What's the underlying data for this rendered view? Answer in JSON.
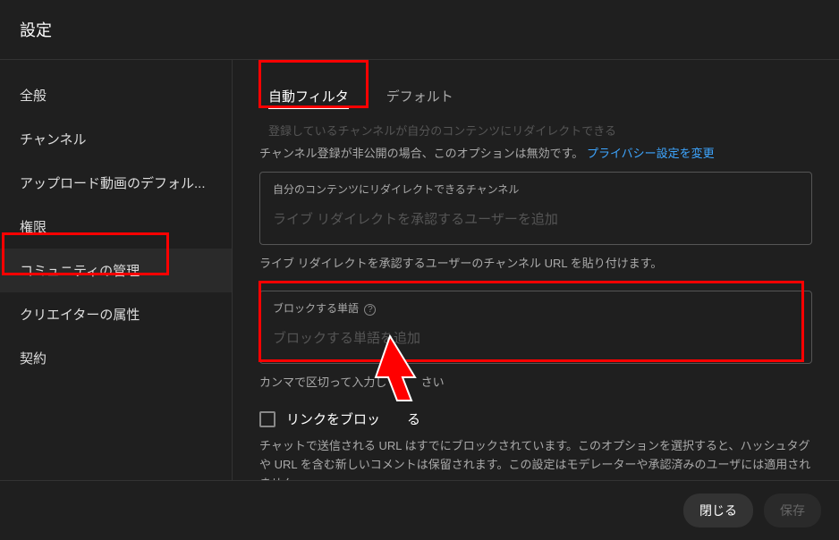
{
  "header": {
    "title": "設定"
  },
  "sidebar": {
    "items": [
      {
        "label": "全般"
      },
      {
        "label": "チャンネル"
      },
      {
        "label": "アップロード動画のデフォル..."
      },
      {
        "label": "権限"
      },
      {
        "label": "コミュニティの管理"
      },
      {
        "label": "クリエイターの属性"
      },
      {
        "label": "契約"
      }
    ]
  },
  "content": {
    "tabs": [
      {
        "label": "自動フィルタ",
        "active": true
      },
      {
        "label": "デフォルト",
        "active": false
      }
    ],
    "greyed_line": "登録しているチャンネルが自分のコンテンツにリダイレクトできる",
    "privacy_note": "チャンネル登録が非公開の場合、このオプションは無効です。",
    "privacy_link": "プライバシー設定を変更",
    "redirect_box": {
      "label": "自分のコンテンツにリダイレクトできるチャンネル",
      "placeholder": "ライブ リダイレクトを承認するユーザーを追加"
    },
    "redirect_help": "ライブ リダイレクトを承認するユーザーのチャンネル URL を貼り付けます。",
    "block_box": {
      "label": "ブロックする単語",
      "placeholder": "ブロックする単語を追加"
    },
    "block_help_partial": "カンマで区切って入力し",
    "block_help_suffix": "さい",
    "checkbox": {
      "label_a": "リンクをブロッ",
      "label_b": "る"
    },
    "description": "チャットで送信される URL はすでにブロックされています。このオプションを選択すると、ハッシュタグや URL を含む新しいコメントは保留されます。この設定はモデレーターや承認済みのユーザには適用されません。"
  },
  "footer": {
    "close": "閉じる",
    "save": "保存"
  }
}
